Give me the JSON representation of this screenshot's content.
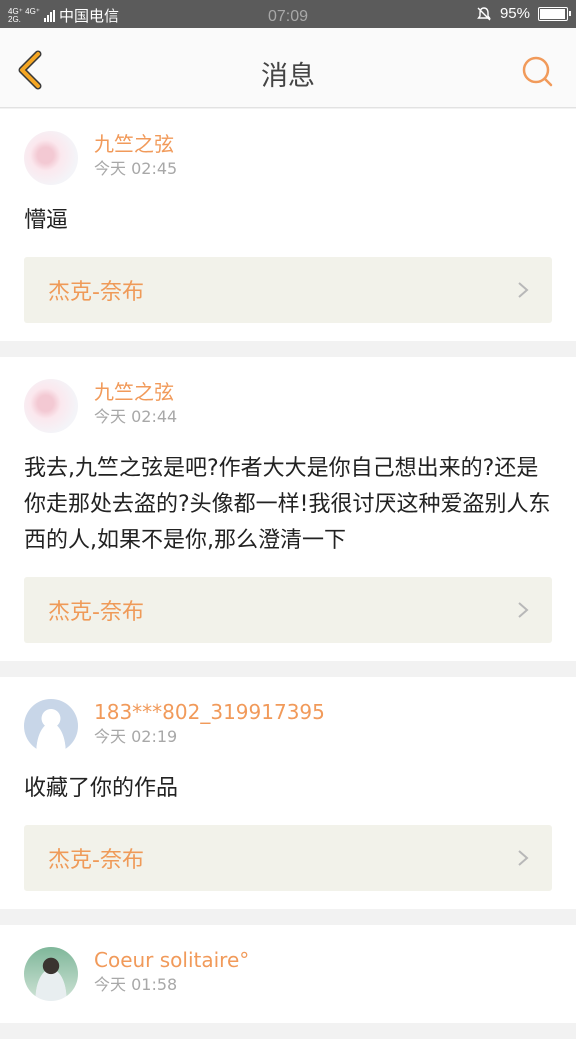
{
  "status_bar": {
    "network_top": "4G⁺ 4G⁺",
    "network_bottom": "2G.",
    "carrier": "中国电信",
    "time": "07:09",
    "battery": "95%",
    "battery_level": 0.95
  },
  "nav": {
    "title": "消息"
  },
  "colors": {
    "accent": "#f19a5a",
    "back_icon": "#f5a623"
  },
  "messages": [
    {
      "avatar": "flower-avatar",
      "username": "九竺之弦",
      "time": "今天 02:45",
      "text": "懵逼",
      "work_title": "杰克-奈布"
    },
    {
      "avatar": "flower-avatar",
      "username": "九竺之弦",
      "time": "今天 02:44",
      "text": "我去,九竺之弦是吧?作者大大是你自己想出来的?还是你走那处去盗的?头像都一样!我很讨厌这种爱盗别人东西的人,如果不是你,那么澄清一下",
      "work_title": "杰克-奈布"
    },
    {
      "avatar": "default-avatar",
      "username": "183***802_319917395",
      "time": "今天 02:19",
      "text": "收藏了你的作品",
      "work_title": "杰克-奈布"
    },
    {
      "avatar": "photo-avatar",
      "username": "Coeur solitaire°",
      "time": "今天 01:58",
      "text": "",
      "work_title": ""
    }
  ]
}
